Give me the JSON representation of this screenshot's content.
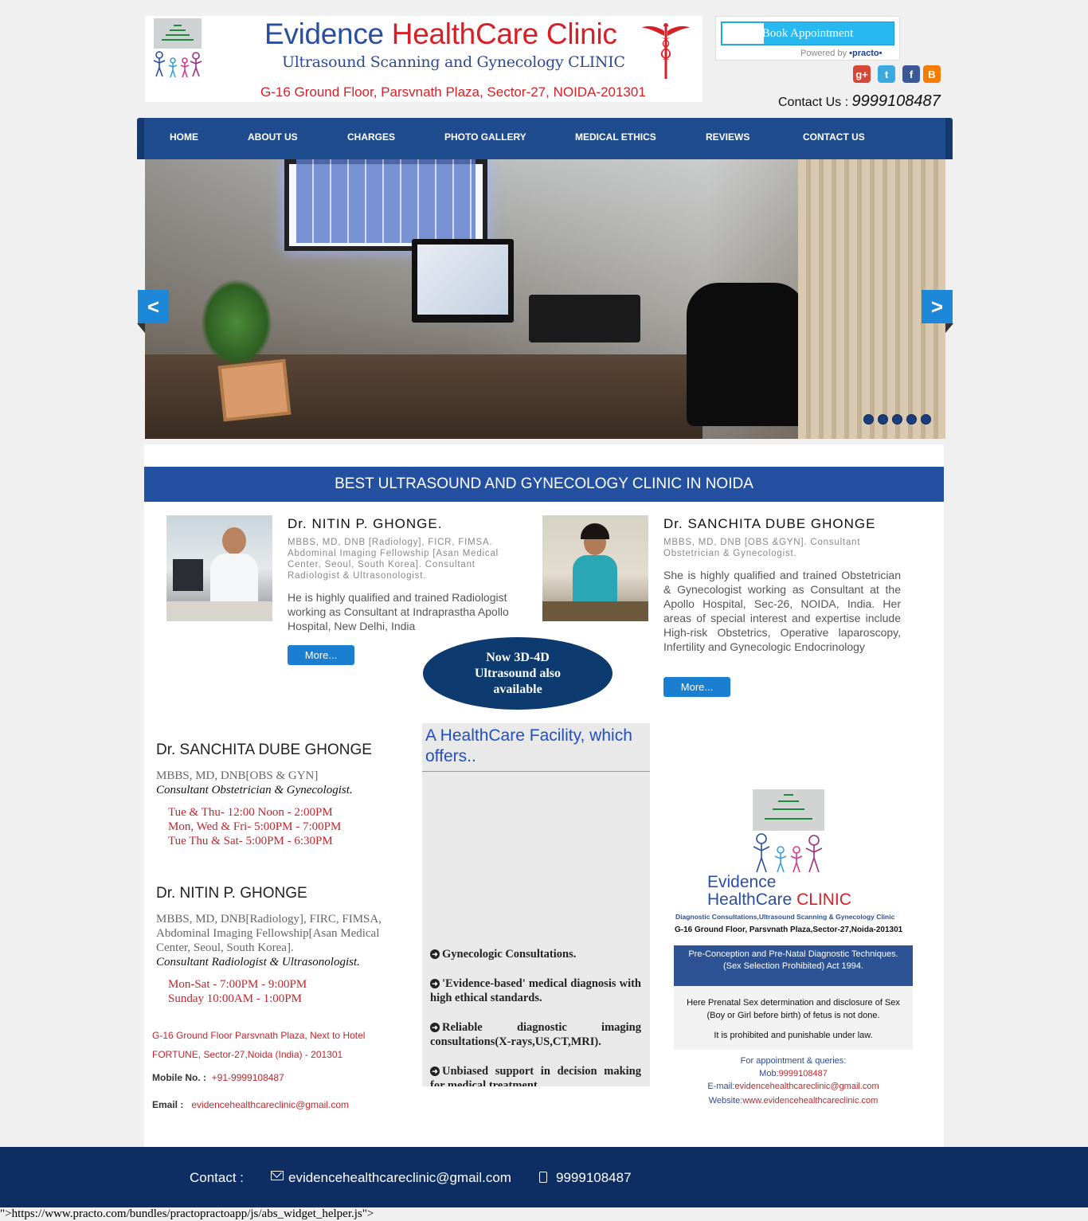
{
  "header": {
    "title_part1": "Evidence",
    "title_part2": "HealthCare Clinic",
    "subtitle": "Ultrasound Scanning and Gynecology CLINIC",
    "address": "G-16 Ground Floor, Parsvnath Plaza, Sector-27, NOIDA-201301",
    "book_label": "Book Appointment",
    "powered_label": "Powered by",
    "powered_brand": "•practo•",
    "contact_label": "Contact Us : ",
    "contact_phone": "9999108487",
    "social_icons": [
      "google-plus-icon",
      "twitter-icon",
      "facebook-icon",
      "blogger-icon"
    ]
  },
  "nav": {
    "items": [
      {
        "label": "HOME"
      },
      {
        "label": "ABOUT US"
      },
      {
        "label": "CHARGES"
      },
      {
        "label": "PHOTO GALLERY"
      },
      {
        "label": "MEDICAL ETHICS"
      },
      {
        "label": "REVIEWS"
      },
      {
        "label": "CONTACT US"
      }
    ]
  },
  "slider": {
    "prev": "<",
    "next": ">",
    "slide_count": 5
  },
  "band_title": "BEST ULTRASOUND AND GYNECOLOGY CLINIC IN NOIDA",
  "doctors": [
    {
      "name": "Dr. NITIN P. GHONGE.",
      "quals": "MBBS, MD, DNB [Radiology], FICR, FIMSA. Abdominal Imaging Fellowship [Asan Medical Center, Seoul, South Korea]. Consultant Radiologist & Ultrasonologist.",
      "desc": "He is highly qualified and trained Radiologist working as Consultant at Indraprastha Apollo Hospital, New Delhi, India",
      "more": "More..."
    },
    {
      "name": "Dr. SANCHITA DUBE GHONGE",
      "quals": "MBBS, MD, DNB [OBS &GYN]. Consultant Obstetrician & Gynecologist.",
      "desc": "She is highly qualified and trained Obstetrician & Gynecologist working as Consultant at the Apollo Hospital, Sec-26, NOIDA, India. Her areas of special interest and expertise include High-risk Obstetrics, Operative laparoscopy, Infertility and Gynecologic Endocrinology",
      "more": "More..."
    }
  ],
  "oval_text": "Now 3D-4D Ultrasound also available",
  "schedule": {
    "sanchita": {
      "name": "Dr. SANCHITA DUBE GHONGE",
      "quals": "MBBS, MD, DNB[OBS & GYN]",
      "role": "Consultant Obstetrician & Gynecologist.",
      "times": [
        "Tue & Thu- 12:00 Noon - 2:00PM",
        "Mon, Wed & Fri- 5:00PM - 7:00PM",
        "Tue Thu & Sat- 5:00PM - 6:30PM"
      ]
    },
    "nitin": {
      "name": "Dr. NITIN P. GHONGE",
      "quals": "MBBS, MD, DNB[Radiology], FIRC, FIMSA, Abdominal Imaging Fellowship[Asan Medical Center, Seoul, South Korea].",
      "role": "Consultant Radiologist & Ultrasonologist.",
      "times": [
        "Mon-Sat - 7:00PM - 9:00PM",
        "Sunday 10:00AM - 1:00PM"
      ]
    },
    "address_line1": "G-16 Ground Floor Parsvnath Plaza, Next to Hotel",
    "address_line2": "FORTUNE, Sector-27,Noida (India) - 201301",
    "mobile_label": "Mobile No. :",
    "mobile": "+91-9999108487",
    "email_label": "Email :",
    "email": "evidencehealthcareclinic@gmail.com"
  },
  "facility": {
    "title": "A HealthCare Facility, which offers..",
    "items": [
      "Gynecologic Consultations.",
      "'Evidence-based' medical diagnosis with high ethical standards.",
      "Reliable diagnostic imaging consultations(X-rays,US,CT,MRI).",
      "Unbiased support in decision making for medical treatment"
    ]
  },
  "card": {
    "title_line1": "Evidence",
    "title_line2a": "HealthCare",
    "title_line2b": "CLINIC",
    "sub": "Diagnostic Consultations,Ultrasound Scanning & Gynecology Clinic",
    "addr": "G-16 Ground Floor, Parsvnath Plaza,Sector-27,Noida-201301",
    "pcpndt": "Pre-Conception and Pre-Natal Diagnostic Techniques. (Sex Selection Prohibited) Act 1994.",
    "prenatal": "Here Prenatal Sex determination and disclosure of Sex (Boy or Girl before birth) of fetus is not done.",
    "prohibited": "It is prohibited and punishable under law.",
    "appt": "For appointment & queries:",
    "mob_label": "Mob:",
    "mob": "9999108487",
    "email_label": "E-mail:",
    "email": "evidencehealthcareclinic@gmail.com",
    "web_label": "Website:",
    "web": "www.evidencehealthcareclinic.com"
  },
  "footer": {
    "contact_label": "Contact :",
    "email": "evidencehealthcareclinic@gmail.com",
    "phone": "9999108487"
  },
  "bottom_text": "\">https://www.practo.com/bundles/practopractoapp/js/abs_widget_helper.js\">",
  "colors": {
    "nav": "#1f4b8f",
    "accent_red": "#d61f26",
    "footer": "#0e2d62",
    "button": "#1a7fd1"
  }
}
